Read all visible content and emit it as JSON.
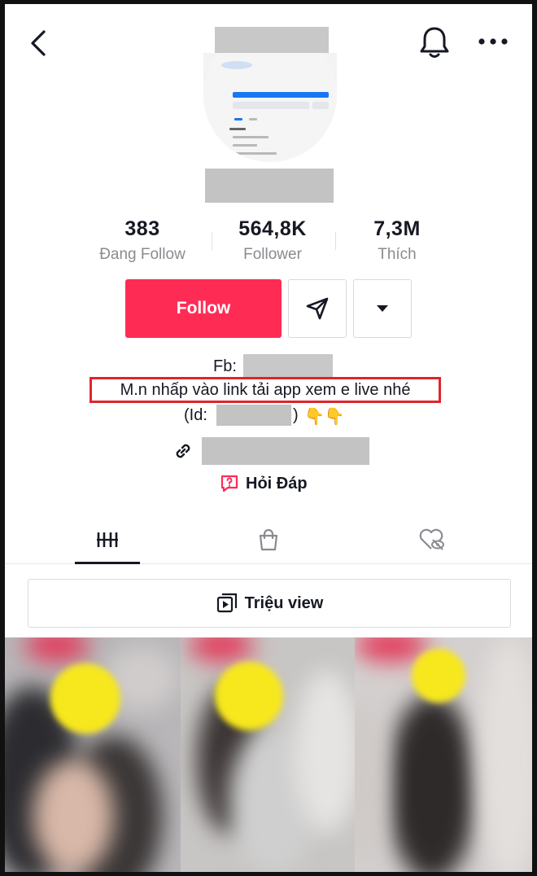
{
  "header": {
    "back_icon": "chevron-left-icon",
    "bell_icon": "bell-icon",
    "more_icon": "more-dots-icon"
  },
  "stats": [
    {
      "value": "383",
      "label": "Đang Follow"
    },
    {
      "value": "564,8K",
      "label": "Follower"
    },
    {
      "value": "7,3M",
      "label": "Thích"
    }
  ],
  "actions": {
    "follow_label": "Follow",
    "message_icon": "send-icon",
    "dropdown_icon": "caret-down-icon"
  },
  "bio": {
    "fb_label": "Fb:",
    "highlight_text": "M.n nhấp vào link tải app xem e live nhé",
    "id_open": "(Id:",
    "id_close": ")",
    "emoji": "👇👇"
  },
  "qa": {
    "label": "Hỏi Đáp",
    "icon": "question-bubble-icon"
  },
  "tabs": [
    {
      "name": "videos",
      "icon": "grid-icon",
      "active": true
    },
    {
      "name": "shop",
      "icon": "shopping-bag-icon",
      "active": false
    },
    {
      "name": "liked",
      "icon": "hidden-heart-icon",
      "active": false
    }
  ],
  "playlist": {
    "label": "Triệu view",
    "icon": "playlist-icon"
  },
  "colors": {
    "accent": "#fe2c55",
    "highlight_border": "#e0242c",
    "text": "#161823",
    "muted": "#8a8b91"
  }
}
